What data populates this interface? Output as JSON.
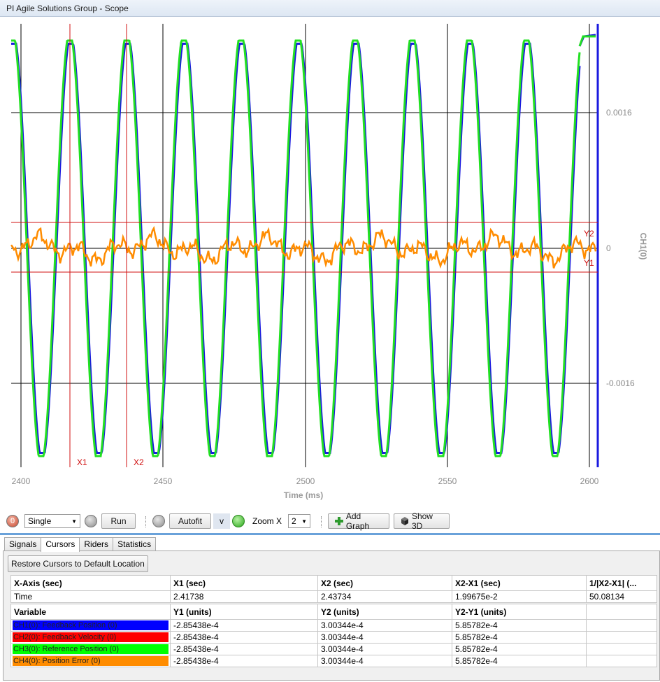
{
  "window": {
    "title": "PI Agile Solutions Group - Scope"
  },
  "plot": {
    "x_ticks": [
      "2400",
      "2450",
      "2500",
      "2550",
      "2600"
    ],
    "x_axis_label": "Time (ms)",
    "y_ticks": [
      "0.0016",
      "0",
      "-0.0016"
    ],
    "y_axis_label": "CH1(0)",
    "cursor_labels": {
      "x1": "X1",
      "x2": "X2",
      "y1": "Y1",
      "y2": "Y2"
    },
    "colors": {
      "ch1": "#1a1adf",
      "ch2": "#e10000",
      "ch3": "#22e022",
      "ch4": "#ff8c00",
      "cursor": "#d01010"
    }
  },
  "toolbar": {
    "status_led": "0",
    "mode_select": "Single",
    "run_label": "Run",
    "autofit_label": "Autofit",
    "v_label": "v",
    "zoom_label": "Zoom X",
    "zoom_value": "2",
    "add_graph_label": "Add Graph",
    "show_3d_label": "Show 3D",
    "icons": [
      "plus-icon",
      "cube-icon",
      "caret-down-icon"
    ]
  },
  "tabs": [
    "Signals",
    "Cursors",
    "Riders",
    "Statistics"
  ],
  "active_tab": "Cursors",
  "cursors": {
    "restore_label": "Restore Cursors to Default Location",
    "x_headers": [
      "X-Axis (sec)",
      "X1 (sec)",
      "X2 (sec)",
      "X2-X1 (sec)",
      "1/|X2-X1| (..."
    ],
    "x_row": [
      "Time",
      "2.41738",
      "2.43734",
      "1.99675e-2",
      "50.08134"
    ],
    "var_headers": [
      "Variable",
      "Y1 (units)",
      "Y2 (units)",
      "Y2-Y1 (units)",
      ""
    ],
    "var_rows": [
      {
        "name": "CH1(0): Feedback Position (0)",
        "color": "#0000ff",
        "y1": "-2.85438e-4",
        "y2": "3.00344e-4",
        "dy": "5.85782e-4"
      },
      {
        "name": "CH2(0): Feedback Velocity (0)",
        "color": "#ff0000",
        "y1": "-2.85438e-4",
        "y2": "3.00344e-4",
        "dy": "5.85782e-4"
      },
      {
        "name": "CH3(0): Reference Position (0)",
        "color": "#00ff00",
        "y1": "-2.85438e-4",
        "y2": "3.00344e-4",
        "dy": "5.85782e-4"
      },
      {
        "name": "CH4(0): Position Error (0)",
        "color": "#ff8c00",
        "y1": "-2.85438e-4",
        "y2": "3.00344e-4",
        "dy": "5.85782e-4"
      }
    ]
  }
}
